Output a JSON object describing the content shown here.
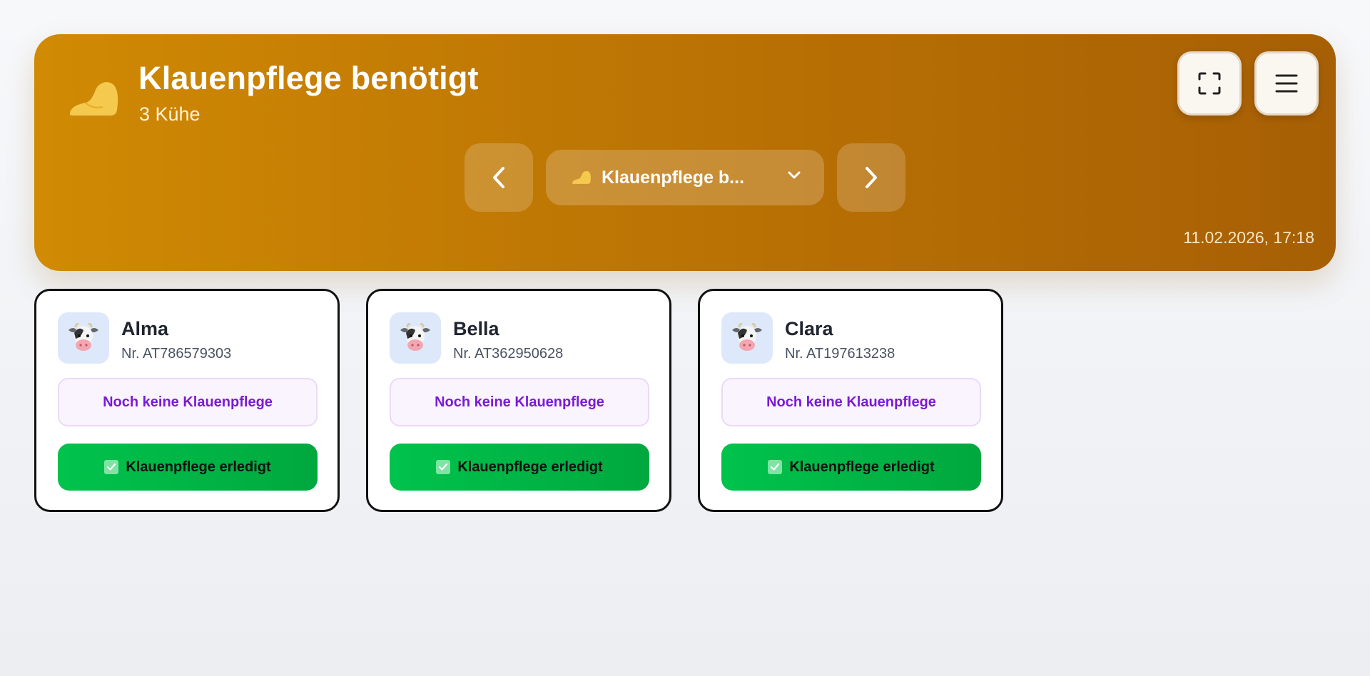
{
  "header": {
    "title": "Klauenpflege benötigt",
    "subtitle": "3 Kühe",
    "icon": "hoof-icon",
    "datetime": "11.02.2026, 17:18",
    "dropdown_label": "Klauenpflege b...",
    "colors": {
      "gradient_start": "#d08a03",
      "gradient_end": "#a75f05"
    }
  },
  "toolbar": {
    "fullscreen_icon": "fullscreen-icon",
    "menu_icon": "hamburger-menu-icon"
  },
  "cows": [
    {
      "name": "Alma",
      "nr": "Nr. AT786579303",
      "status": "Noch keine Klauenpflege",
      "action": "Klauenpflege erledigt"
    },
    {
      "name": "Bella",
      "nr": "Nr. AT362950628",
      "status": "Noch keine Klauenpflege",
      "action": "Klauenpflege erledigt"
    },
    {
      "name": "Clara",
      "nr": "Nr. AT197613238",
      "status": "Noch keine Klauenpflege",
      "action": "Klauenpflege erledigt"
    }
  ],
  "colors": {
    "status_text": "#7a1ad6",
    "action_green": "#00c34c",
    "avatar_bg": "#dde9fb"
  }
}
